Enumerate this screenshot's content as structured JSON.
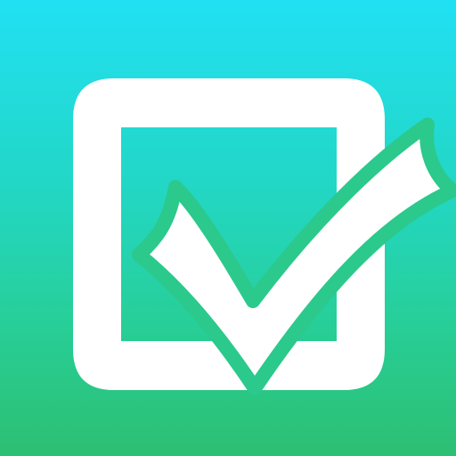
{
  "icon": {
    "name": "checkbox-checkmark-icon",
    "colors": {
      "gradient_top": "#21E0F3",
      "gradient_upper_mid": "#22D7C6",
      "gradient_lower_mid": "#27CF99",
      "gradient_bottom": "#2DBF72",
      "glyph": "#FFFFFF",
      "checkmark_outline": "#2BC98C"
    }
  }
}
